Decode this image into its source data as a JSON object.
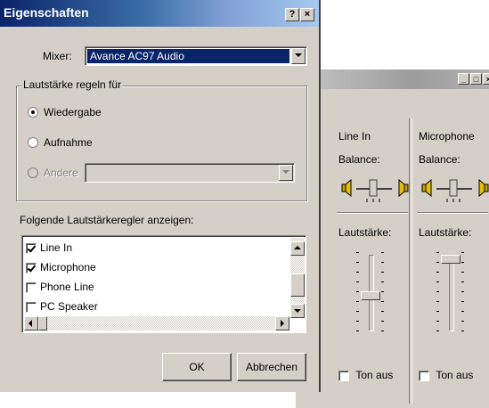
{
  "volume_window": {
    "title": "",
    "title_buttons": {
      "minimize": "_",
      "maximize": "□",
      "close": "×"
    },
    "channels": [
      {
        "name": "Line In",
        "balance_label": "Balance:",
        "volume_label": "Lautstärke:",
        "volume_level": 0.45,
        "mute_label": "Ton aus",
        "mute_checked": false
      },
      {
        "name": "Microphone",
        "balance_label": "Balance:",
        "volume_label": "Lautstärke:",
        "volume_level": 1.0,
        "mute_label": "Ton aus",
        "mute_checked": false
      }
    ]
  },
  "dialog": {
    "title": "Eigenschaften",
    "title_buttons": {
      "help": "?",
      "close": "×"
    },
    "mixer_label": "Mixer:",
    "mixer_value": "Avance AC97 Audio",
    "group_title": "Lautstärke regeln für",
    "radio_playback": "Wiedergabe",
    "radio_recording": "Aufnahme",
    "radio_other": "Andere",
    "other_value": "",
    "list_label": "Folgende Lautstärkeregler anzeigen:",
    "list_items": [
      {
        "label": "Line In",
        "checked": true
      },
      {
        "label": "Microphone",
        "checked": true
      },
      {
        "label": "Phone Line",
        "checked": false
      },
      {
        "label": "PC Speaker",
        "checked": false
      }
    ],
    "ok_label": "OK",
    "cancel_label": "Abbrechen"
  },
  "colors": {
    "titlebar_active": "#0a246a",
    "titlebar_inactive": "#9d9d9d",
    "selection": "#0a246a",
    "face": "#d4d0c8"
  }
}
